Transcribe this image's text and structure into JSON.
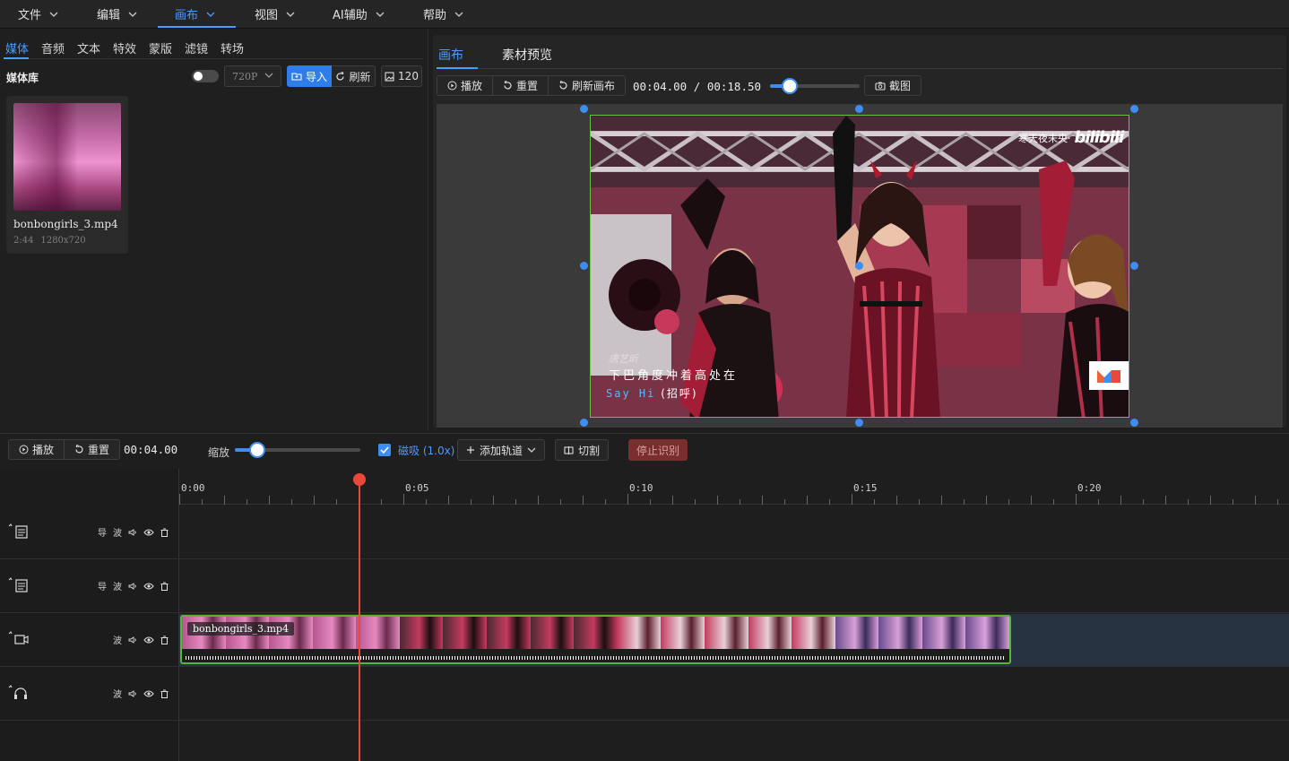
{
  "menu": {
    "items": [
      {
        "label": "文件"
      },
      {
        "label": "编辑"
      },
      {
        "label": "画布",
        "active": true
      },
      {
        "label": "视图"
      },
      {
        "label": "AI辅助"
      },
      {
        "label": "帮助"
      }
    ]
  },
  "left_panel": {
    "tabs": [
      "媒体",
      "音频",
      "文本",
      "特效",
      "蒙版",
      "滤镜",
      "转场"
    ],
    "active_tab": "媒体",
    "library_title": "媒体库",
    "resolution_select": "720P",
    "import_label": "导入",
    "refresh_label": "刷新",
    "count_label": "120",
    "media_items": [
      {
        "name": "bonbongirls_3.mp4",
        "duration": "2:44",
        "resolution": "1280x720"
      }
    ]
  },
  "canvas_panel": {
    "tabs": [
      "画布",
      "素材预览"
    ],
    "active_tab": "画布",
    "play_label": "播放",
    "reset_label": "重置",
    "refresh_canvas_label": "刷新画布",
    "current_time": "00:04.00",
    "separator": "/",
    "total_time": "00:18.50",
    "progress_fraction": 0.216,
    "screenshot_label": "截图",
    "video_overlay": {
      "watermark_text": "寒天夜未央·",
      "watermark_brand": "bilibili",
      "subtitle_name": "唐艺昕",
      "subtitle_main": "下巴角度冲着高处在",
      "subtitle_second_en": "Say Hi",
      "subtitle_second_zh": "(招呼)"
    }
  },
  "timeline": {
    "play_label": "播放",
    "reset_label": "重置",
    "current_time": "00:04.00",
    "zoom_label": "缩放",
    "zoom_fraction": 0.18,
    "snap_label": "磁吸 (1.0x)",
    "snap_checked": true,
    "add_track_label": "添加轨道",
    "cut_label": "切割",
    "stop_recognition_label": "停止识别",
    "ruler_labels": [
      "0:00",
      "0:05",
      "0:10",
      "0:15",
      "0:20"
    ],
    "tracks": [
      {
        "type": "text",
        "controls": [
          "导",
          "波"
        ]
      },
      {
        "type": "text",
        "controls": [
          "导",
          "波"
        ]
      },
      {
        "type": "video",
        "controls": [
          "波"
        ]
      },
      {
        "type": "audio",
        "controls": [
          "波"
        ]
      }
    ],
    "clip": {
      "label": "bonbongirls_3.mp4"
    }
  },
  "colors": {
    "accent": "#3d8ef2",
    "clip_border": "#57b53a",
    "playhead": "#e8493a",
    "stop_button": "#7a2e2e"
  }
}
